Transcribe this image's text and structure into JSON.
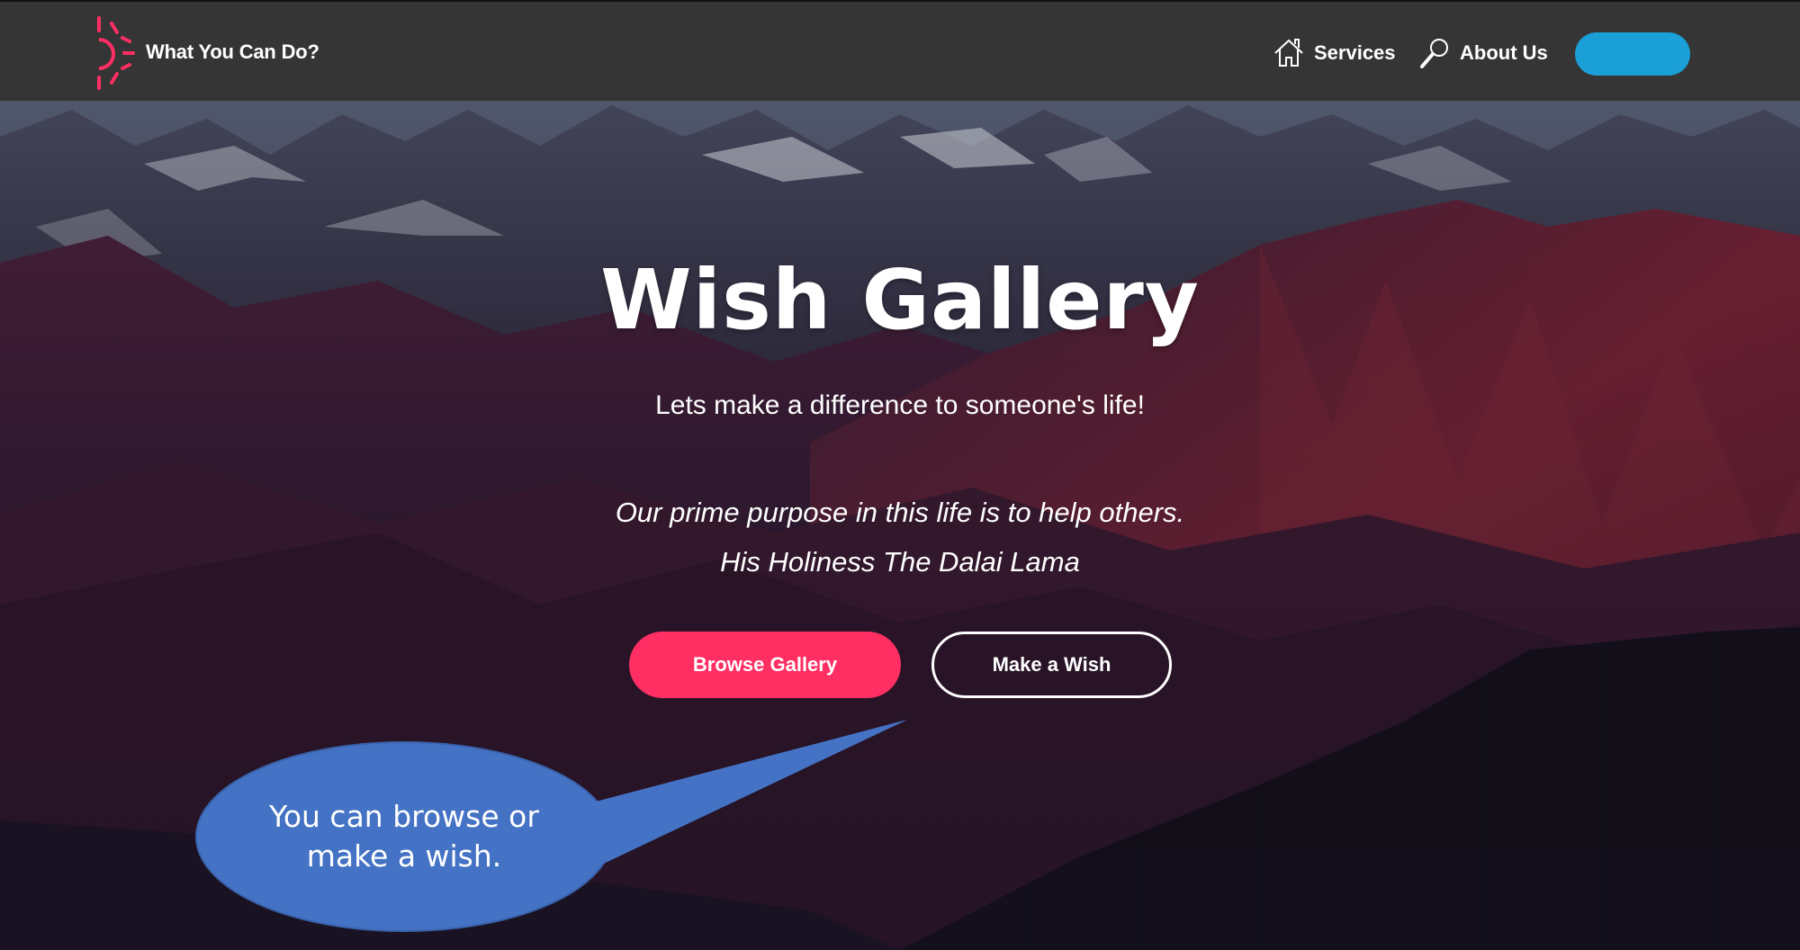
{
  "header": {
    "brand_text": "What You Can Do?",
    "logo_icon": "sun-icon",
    "nav": [
      {
        "label": "Services",
        "icon": "home-icon"
      },
      {
        "label": "About Us",
        "icon": "magnifier-icon"
      }
    ],
    "cta_label": ""
  },
  "hero": {
    "title": "Wish Gallery",
    "subtitle": "Lets make a difference to someone's life!",
    "quote_line1": "Our prime purpose in this life is to help others.",
    "quote_line2": "His Holiness The Dalai Lama",
    "browse_button": "Browse Gallery",
    "wish_button": "Make a Wish"
  },
  "callout": {
    "line1": "You can browse or",
    "line2": "make a wish."
  },
  "colors": {
    "navbar": "#353535",
    "accent_pink": "#ff2e63",
    "accent_blue": "#1a9fd6",
    "callout_fill": "#4472c4"
  }
}
